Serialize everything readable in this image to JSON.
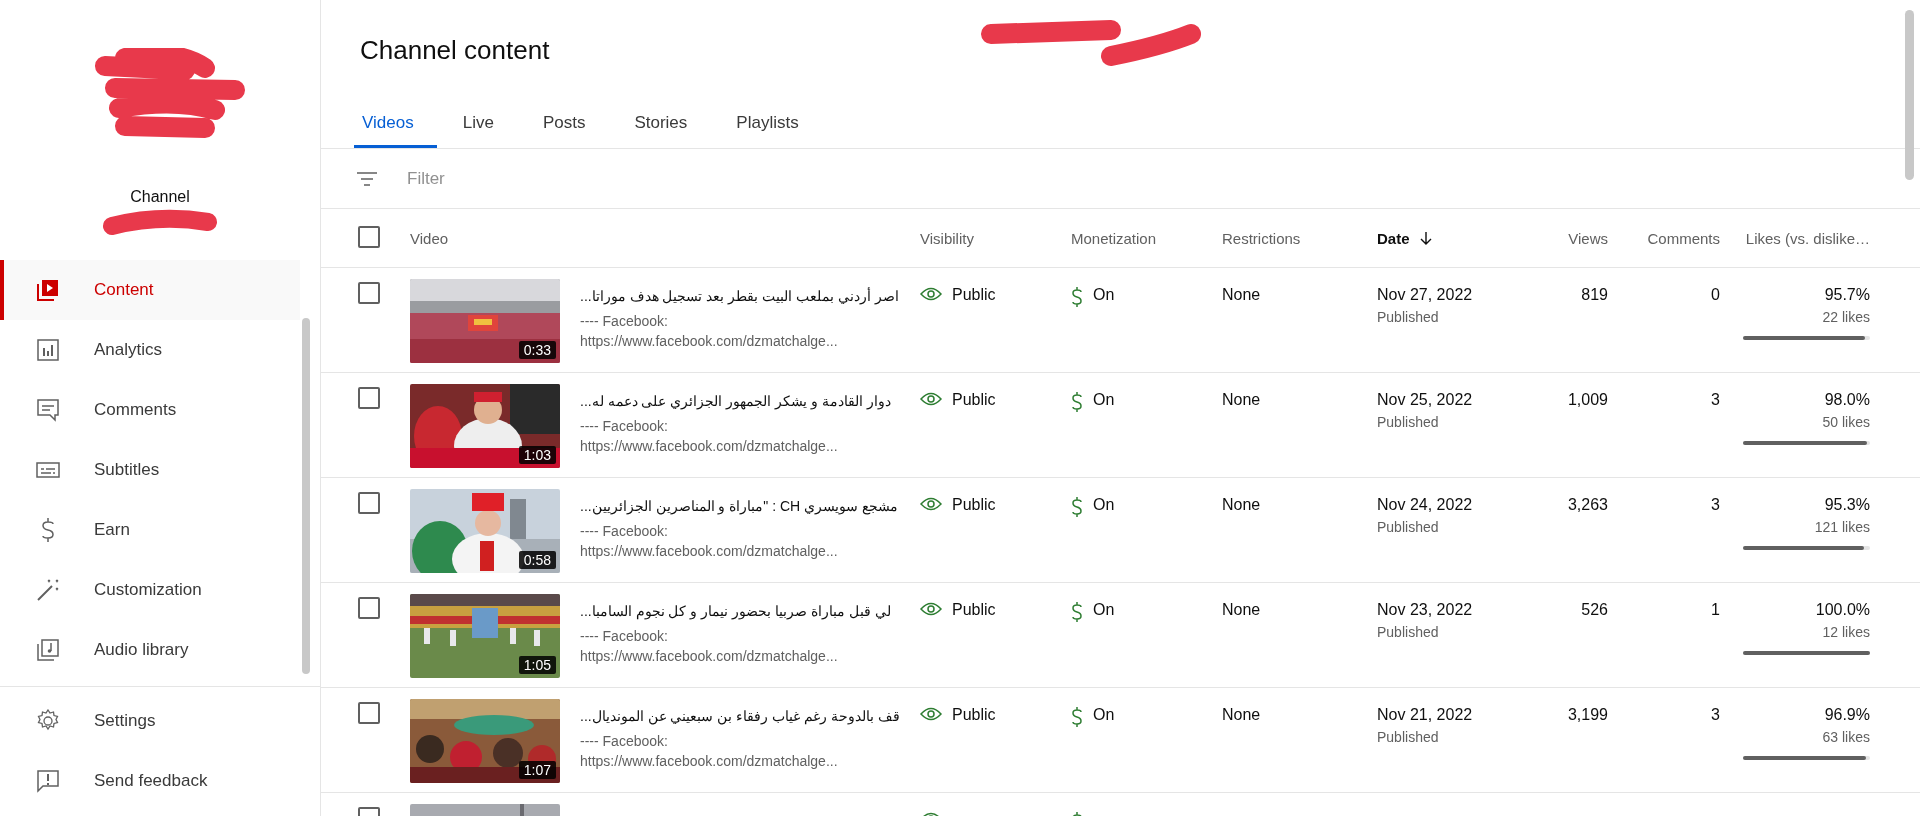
{
  "sidebar": {
    "channel_label": "Channel",
    "items": [
      {
        "label": "Content",
        "kind": "content",
        "selected": true
      },
      {
        "label": "Analytics",
        "kind": "analytics",
        "selected": false
      },
      {
        "label": "Comments",
        "kind": "comments",
        "selected": false
      },
      {
        "label": "Subtitles",
        "kind": "subtitles",
        "selected": false
      },
      {
        "label": "Earn",
        "kind": "earn",
        "selected": false
      },
      {
        "label": "Customization",
        "kind": "customization",
        "selected": false
      },
      {
        "label": "Audio library",
        "kind": "audio",
        "selected": false
      }
    ],
    "footer_items": [
      {
        "label": "Settings",
        "kind": "settings"
      },
      {
        "label": "Send feedback",
        "kind": "feedback"
      }
    ]
  },
  "page": {
    "title": "Channel content"
  },
  "tabs": [
    {
      "label": "Videos",
      "selected": true
    },
    {
      "label": "Live",
      "selected": false
    },
    {
      "label": "Posts",
      "selected": false
    },
    {
      "label": "Stories",
      "selected": false
    },
    {
      "label": "Playlists",
      "selected": false
    }
  ],
  "filter": {
    "placeholder": "Filter"
  },
  "table": {
    "select_all": {
      "checked": false
    },
    "columns": [
      {
        "label": "Video",
        "sorted": false
      },
      {
        "label": "Visibility",
        "sorted": false
      },
      {
        "label": "Monetization",
        "sorted": false
      },
      {
        "label": "Restrictions",
        "sorted": false
      },
      {
        "label": "Date",
        "sorted": true
      },
      {
        "label": "Views",
        "sorted": false
      },
      {
        "label": "Comments",
        "sorted": false
      },
      {
        "label": "Likes (vs. dislike…",
        "sorted": false
      }
    ],
    "rows": [
      {
        "checked": false,
        "duration": "0:33",
        "title": "اصر أردني بملعب البيت بقطر بعد تسجيل هدف موراتا...",
        "description": "---- Facebook:",
        "link": "https://www.facebook.com/dzmatchalge...",
        "visibility": "Public",
        "monetization": "On",
        "restrictions": "None",
        "date": "Nov 27, 2022",
        "status": "Published",
        "views": "819",
        "comments": "0",
        "likes_percent": "95.7%",
        "likes": "22 likes",
        "level": 0.957
      },
      {
        "checked": false,
        "duration": "1:03",
        "title": "دوار القادمة و يشكر الجمهور الجزائري على دعمه له...",
        "description": "---- Facebook:",
        "link": "https://www.facebook.com/dzmatchalge...",
        "visibility": "Public",
        "monetization": "On",
        "restrictions": "None",
        "date": "Nov 25, 2022",
        "status": "Published",
        "views": "1,009",
        "comments": "3",
        "likes_percent": "98.0%",
        "likes": "50 likes",
        "level": 0.98
      },
      {
        "checked": false,
        "duration": "0:58",
        "title": "مشجع سويسري CH : \"مباراة و المناصرين الجزائريين...",
        "description": "---- Facebook:",
        "link": "https://www.facebook.com/dzmatchalge...",
        "visibility": "Public",
        "monetization": "On",
        "restrictions": "None",
        "date": "Nov 24, 2022",
        "status": "Published",
        "views": "3,263",
        "comments": "3",
        "likes_percent": "95.3%",
        "likes": "121 likes",
        "level": 0.953
      },
      {
        "checked": false,
        "duration": "1:05",
        "title": "لي قبل مباراة صربيا بحضور نيمار و كل نجوم السامبا...",
        "description": "---- Facebook:",
        "link": "https://www.facebook.com/dzmatchalge...",
        "visibility": "Public",
        "monetization": "On",
        "restrictions": "None",
        "date": "Nov 23, 2022",
        "status": "Published",
        "views": "526",
        "comments": "1",
        "likes_percent": "100.0%",
        "likes": "12 likes",
        "level": 1.0
      },
      {
        "checked": false,
        "duration": "1:07",
        "title": "قف بالدوحة رغم غياب رفقاء بن سبعيني عن المونديال...",
        "description": "---- Facebook:",
        "link": "https://www.facebook.com/dzmatchalge...",
        "visibility": "Public",
        "monetization": "On",
        "restrictions": "None",
        "date": "Nov 21, 2022",
        "status": "Published",
        "views": "3,199",
        "comments": "3",
        "likes_percent": "96.9%",
        "likes": "63 likes",
        "level": 0.969
      }
    ],
    "clipped_row": {
      "checked": false
    }
  }
}
